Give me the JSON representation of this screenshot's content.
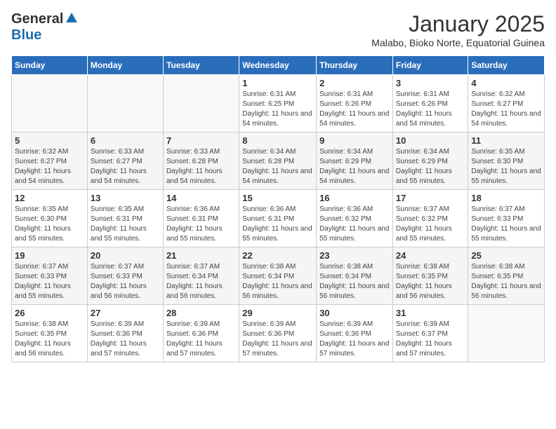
{
  "header": {
    "logo_general": "General",
    "logo_blue": "Blue",
    "month_title": "January 2025",
    "subtitle": "Malabo, Bioko Norte, Equatorial Guinea"
  },
  "weekdays": [
    "Sunday",
    "Monday",
    "Tuesday",
    "Wednesday",
    "Thursday",
    "Friday",
    "Saturday"
  ],
  "weeks": [
    [
      {
        "day": "",
        "info": ""
      },
      {
        "day": "",
        "info": ""
      },
      {
        "day": "",
        "info": ""
      },
      {
        "day": "1",
        "info": "Sunrise: 6:31 AM\nSunset: 6:25 PM\nDaylight: 11 hours and 54 minutes."
      },
      {
        "day": "2",
        "info": "Sunrise: 6:31 AM\nSunset: 6:26 PM\nDaylight: 11 hours and 54 minutes."
      },
      {
        "day": "3",
        "info": "Sunrise: 6:31 AM\nSunset: 6:26 PM\nDaylight: 11 hours and 54 minutes."
      },
      {
        "day": "4",
        "info": "Sunrise: 6:32 AM\nSunset: 6:27 PM\nDaylight: 11 hours and 54 minutes."
      }
    ],
    [
      {
        "day": "5",
        "info": "Sunrise: 6:32 AM\nSunset: 6:27 PM\nDaylight: 11 hours and 54 minutes."
      },
      {
        "day": "6",
        "info": "Sunrise: 6:33 AM\nSunset: 6:27 PM\nDaylight: 11 hours and 54 minutes."
      },
      {
        "day": "7",
        "info": "Sunrise: 6:33 AM\nSunset: 6:28 PM\nDaylight: 11 hours and 54 minutes."
      },
      {
        "day": "8",
        "info": "Sunrise: 6:34 AM\nSunset: 6:28 PM\nDaylight: 11 hours and 54 minutes."
      },
      {
        "day": "9",
        "info": "Sunrise: 6:34 AM\nSunset: 6:29 PM\nDaylight: 11 hours and 54 minutes."
      },
      {
        "day": "10",
        "info": "Sunrise: 6:34 AM\nSunset: 6:29 PM\nDaylight: 11 hours and 55 minutes."
      },
      {
        "day": "11",
        "info": "Sunrise: 6:35 AM\nSunset: 6:30 PM\nDaylight: 11 hours and 55 minutes."
      }
    ],
    [
      {
        "day": "12",
        "info": "Sunrise: 6:35 AM\nSunset: 6:30 PM\nDaylight: 11 hours and 55 minutes."
      },
      {
        "day": "13",
        "info": "Sunrise: 6:35 AM\nSunset: 6:31 PM\nDaylight: 11 hours and 55 minutes."
      },
      {
        "day": "14",
        "info": "Sunrise: 6:36 AM\nSunset: 6:31 PM\nDaylight: 11 hours and 55 minutes."
      },
      {
        "day": "15",
        "info": "Sunrise: 6:36 AM\nSunset: 6:31 PM\nDaylight: 11 hours and 55 minutes."
      },
      {
        "day": "16",
        "info": "Sunrise: 6:36 AM\nSunset: 6:32 PM\nDaylight: 11 hours and 55 minutes."
      },
      {
        "day": "17",
        "info": "Sunrise: 6:37 AM\nSunset: 6:32 PM\nDaylight: 11 hours and 55 minutes."
      },
      {
        "day": "18",
        "info": "Sunrise: 6:37 AM\nSunset: 6:33 PM\nDaylight: 11 hours and 55 minutes."
      }
    ],
    [
      {
        "day": "19",
        "info": "Sunrise: 6:37 AM\nSunset: 6:33 PM\nDaylight: 11 hours and 55 minutes."
      },
      {
        "day": "20",
        "info": "Sunrise: 6:37 AM\nSunset: 6:33 PM\nDaylight: 11 hours and 56 minutes."
      },
      {
        "day": "21",
        "info": "Sunrise: 6:37 AM\nSunset: 6:34 PM\nDaylight: 11 hours and 56 minutes."
      },
      {
        "day": "22",
        "info": "Sunrise: 6:38 AM\nSunset: 6:34 PM\nDaylight: 11 hours and 56 minutes."
      },
      {
        "day": "23",
        "info": "Sunrise: 6:38 AM\nSunset: 6:34 PM\nDaylight: 11 hours and 56 minutes."
      },
      {
        "day": "24",
        "info": "Sunrise: 6:38 AM\nSunset: 6:35 PM\nDaylight: 11 hours and 56 minutes."
      },
      {
        "day": "25",
        "info": "Sunrise: 6:38 AM\nSunset: 6:35 PM\nDaylight: 11 hours and 56 minutes."
      }
    ],
    [
      {
        "day": "26",
        "info": "Sunrise: 6:38 AM\nSunset: 6:35 PM\nDaylight: 11 hours and 56 minutes."
      },
      {
        "day": "27",
        "info": "Sunrise: 6:39 AM\nSunset: 6:36 PM\nDaylight: 11 hours and 57 minutes."
      },
      {
        "day": "28",
        "info": "Sunrise: 6:39 AM\nSunset: 6:36 PM\nDaylight: 11 hours and 57 minutes."
      },
      {
        "day": "29",
        "info": "Sunrise: 6:39 AM\nSunset: 6:36 PM\nDaylight: 11 hours and 57 minutes."
      },
      {
        "day": "30",
        "info": "Sunrise: 6:39 AM\nSunset: 6:36 PM\nDaylight: 11 hours and 57 minutes."
      },
      {
        "day": "31",
        "info": "Sunrise: 6:39 AM\nSunset: 6:37 PM\nDaylight: 11 hours and 57 minutes."
      },
      {
        "day": "",
        "info": ""
      }
    ]
  ]
}
